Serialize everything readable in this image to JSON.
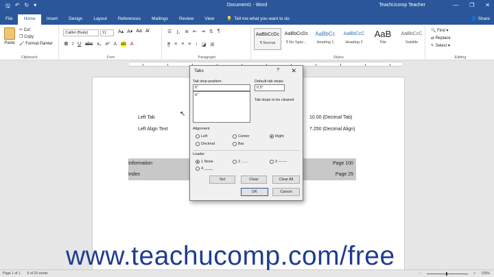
{
  "titlebar": {
    "doc_title": "Document1 - Word",
    "user": "TeachUcomp Teacher",
    "minimize_glyph": "—",
    "restore_glyph": "❐",
    "close_glyph": "✕"
  },
  "ribbon_tabs": [
    "File",
    "Home",
    "Insert",
    "Design",
    "Layout",
    "References",
    "Mailings",
    "Review",
    "View"
  ],
  "tell_me": "Tell me what you want to do",
  "share": "Share",
  "clipboard": {
    "paste": "Paste",
    "cut": "Cut",
    "copy": "Copy",
    "format_painter": "Format Painter",
    "label": "Clipboard"
  },
  "font": {
    "name": "Calibri (Body)",
    "size": "11",
    "label": "Font"
  },
  "paragraph": {
    "label": "Paragraph"
  },
  "styles": {
    "label": "Styles",
    "items": [
      {
        "preview": "AaBbCcDc",
        "name": "¶ Normal"
      },
      {
        "preview": "AaBbCcDc",
        "name": "¶ No Spac..."
      },
      {
        "preview": "AaBbCc",
        "name": "Heading 1"
      },
      {
        "preview": "AaBbCcC",
        "name": "Heading 2"
      },
      {
        "preview": "AaB",
        "name": "Title"
      },
      {
        "preview": "AaBbCcC",
        "name": "Subtitle"
      }
    ]
  },
  "editing": {
    "find": "Find",
    "replace": "Replace",
    "select": "Select",
    "label": "Editing"
  },
  "document": {
    "left_tab": "Left Tab",
    "decimal_tab": "10.00 (Decimal Tab)",
    "left_align_text": "Left Align Text",
    "decimal_align": "7.250 (Decimal Align)",
    "row1_left": "Information",
    "row1_right": "Page 100",
    "row2_left": "Index",
    "row2_right": "Page 25"
  },
  "dialog": {
    "title": "Tabs",
    "help": "?",
    "close": "✕",
    "tab_stop_label": "Tab stop position:",
    "tab_stop_value": "6\"",
    "tab_list_item": "6\"",
    "default_label": "Default tab stops:",
    "default_value": "0.5\"",
    "cleared_label": "Tab stops to be cleared:",
    "alignment_label": "Alignment",
    "align_left": "Left",
    "align_center": "Center",
    "align_right": "Right",
    "align_decimal": "Decimal",
    "align_bar": "Bar",
    "leader_label": "Leader",
    "leader_1": "1 None",
    "leader_2": "2 .......",
    "leader_3": "3 -------",
    "leader_4": "4 ____",
    "set": "Set",
    "clear": "Clear",
    "clear_all": "Clear All",
    "ok": "OK",
    "cancel": "Cancel"
  },
  "status": {
    "page": "Page 1 of 1",
    "words": "6 of 20 words",
    "zoom": "100%"
  },
  "watermark": "www.teachucomp.com/free"
}
